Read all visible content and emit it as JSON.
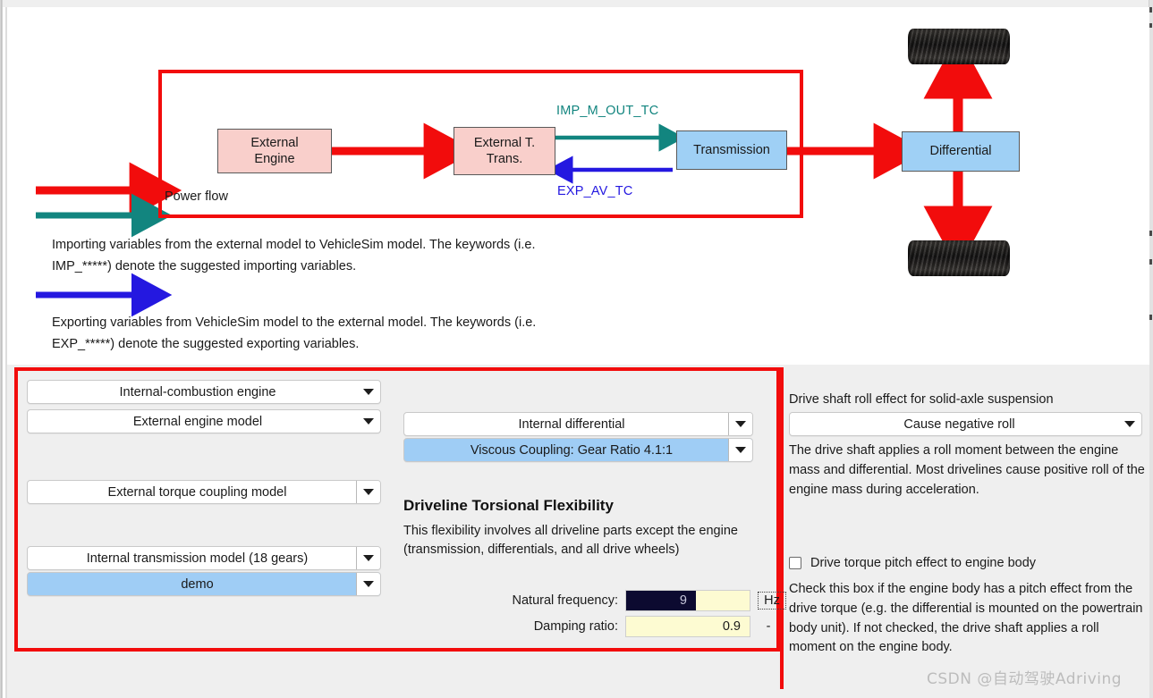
{
  "diagram": {
    "nodes": [
      {
        "id": "external-engine",
        "label": "External\nEngine",
        "color": "#f9cfcb"
      },
      {
        "id": "external-t-trans",
        "label": "External T.\nTrans.",
        "color": "#f9cfcb"
      },
      {
        "id": "transmission",
        "label": "Transmission",
        "color": "#9fd0f5"
      },
      {
        "id": "differential",
        "label": "Differential",
        "color": "#9fd0f5"
      }
    ],
    "node_labels": {
      "external_engine_line1": "External",
      "external_engine_line2": "Engine",
      "external_t_trans_line1": "External T.",
      "external_t_trans_line2": "Trans.",
      "transmission": "Transmission",
      "differential": "Differential"
    },
    "signal_labels": {
      "import_signal": "IMP_M_OUT_TC",
      "export_signal": "EXP_AV_TC"
    },
    "colors": {
      "power_flow": "#f20c0c",
      "import_arrow": "#12857f",
      "export_arrow": "#2418e0",
      "highlight_box": "#f20c0c"
    },
    "legend": {
      "power_flow": "Power flow",
      "import_text": "Importing variables from the external model to VehicleSim model. The keywords (i.e. IMP_*****) denote the suggested importing variables.",
      "export_text": "Exporting variables from VehicleSim model to the external model. The keywords (i.e. EXP_*****) denote the suggested exporting variables."
    }
  },
  "left_panel": {
    "engine_type": "Internal-combustion engine",
    "engine_model": "External engine model",
    "torque_coupling": "External torque coupling model",
    "transmission_model": "Internal transmission model (18 gears)",
    "transmission_dataset": "demo"
  },
  "middle_panel": {
    "differential": "Internal differential",
    "differential_config": "Viscous Coupling: Gear Ratio 4.1:1",
    "section_title": "Driveline Torsional Flexibility",
    "section_desc": "This flexibility involves all driveline parts except the engine (transmission, differentials, and all drive wheels)",
    "natural_frequency_label": "Natural frequency:",
    "natural_frequency_value": "9",
    "natural_frequency_unit": "Hz",
    "damping_ratio_label": "Damping ratio:",
    "damping_ratio_value": "0.9",
    "damping_ratio_unit": "-"
  },
  "right_panel": {
    "roll_effect_title": "Drive shaft roll effect for solid-axle suspension",
    "roll_effect_value": "Cause negative roll",
    "roll_effect_desc": "The drive shaft applies a roll moment between the engine mass and differential.  Most drivelines cause positive roll of the engine mass during acceleration.",
    "pitch_checkbox_label": "Drive torque pitch effect to engine body",
    "pitch_checkbox_checked": false,
    "pitch_desc": "Check this box if the engine body has a pitch effect from the drive torque (e.g. the differential is mounted on the powertrain body unit). If not checked, the drive shaft applies a roll moment on the engine body."
  },
  "watermark": "CSDN @自动驾驶Adriving"
}
